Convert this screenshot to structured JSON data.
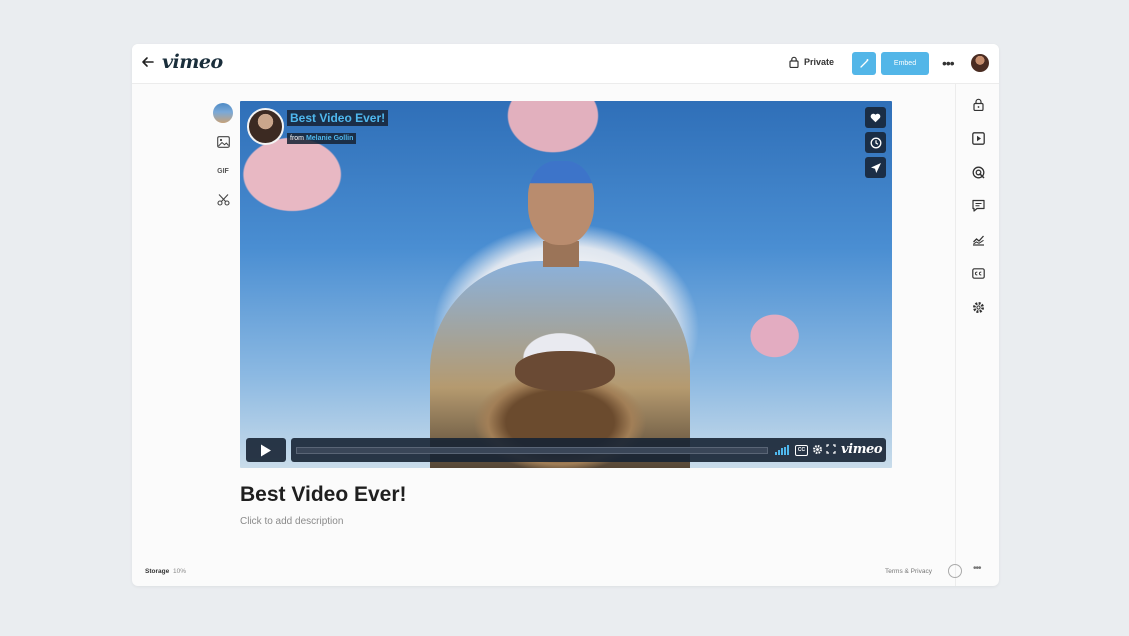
{
  "app": {
    "logo": "vimeo"
  },
  "topbar": {
    "privacy_label": "Private",
    "share_label": "Embed",
    "more_label": "•••"
  },
  "left_tools": {
    "gif_label": "GIF"
  },
  "player": {
    "video_title": "Best Video Ever!",
    "from_prefix": "from",
    "author": "Melanie Gollin",
    "brand": "vimeo",
    "cc_label": "CC",
    "progress_fraction": 0.0,
    "accent_color": "#4fb8ee"
  },
  "video": {
    "title": "Best Video Ever!",
    "description_placeholder": "Click to add description"
  },
  "footer": {
    "storage_label": "Storage",
    "storage_value": "10%",
    "links": "Terms & Privacy",
    "more_label": "•••"
  },
  "icons": {
    "back": "arrow-left-icon",
    "lock": "lock-icon",
    "wand": "magic-wand-icon",
    "image": "image-icon",
    "scissors": "scissors-icon",
    "heart": "heart-icon",
    "clock": "clock-icon",
    "send": "paper-plane-icon",
    "play": "play-icon",
    "panel": [
      "lock-icon",
      "play-square-icon",
      "target-icon",
      "comment-icon",
      "analytics-icon",
      "captions-icon",
      "settings-icon"
    ]
  }
}
